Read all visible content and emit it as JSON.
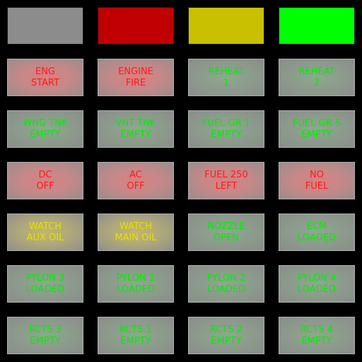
{
  "status_lights": [
    {
      "name": "status-light-gray",
      "color": "#8c8c8c"
    },
    {
      "name": "status-light-red",
      "color": "#c00000"
    },
    {
      "name": "status-light-yellow",
      "color": "#c8c000"
    },
    {
      "name": "status-light-green",
      "color": "#00ff00"
    }
  ],
  "colors": {
    "red_text": "#ff1a1a",
    "yellow_text": "#e8e000",
    "green_text": "#00ee00",
    "lamp_body": "#8c8c8c",
    "background": "#000000"
  },
  "annunciators": [
    {
      "id": "eng-start",
      "line1": "ENG",
      "line2": "START",
      "color": "red"
    },
    {
      "id": "engine-fire",
      "line1": "ENGINE",
      "line2": "FIRE",
      "color": "red"
    },
    {
      "id": "reheat-1",
      "line1": "REHEAT",
      "line2": "1",
      "color": "green"
    },
    {
      "id": "reheat-2",
      "line1": "REHEAT",
      "line2": "2",
      "color": "green"
    },
    {
      "id": "wng-tnk-empty",
      "line1": "WNG TNK",
      "line2": "EMPTY",
      "color": "green"
    },
    {
      "id": "vnt-tnk-empty",
      "line1": "VNT TNK",
      "line2": "EMPTY",
      "color": "green"
    },
    {
      "id": "fuel-gr-1-empty",
      "line1": "FUEL GR 1",
      "line2": "EMPTY",
      "color": "green"
    },
    {
      "id": "fuel-gr-5-empty",
      "line1": "FUEL GR 5",
      "line2": "EMPTY",
      "color": "green"
    },
    {
      "id": "dc-off",
      "line1": "DC",
      "line2": "OFF",
      "color": "red"
    },
    {
      "id": "ac-off",
      "line1": "AC",
      "line2": "OFF",
      "color": "red"
    },
    {
      "id": "fuel-250-left",
      "line1": "FUEL 250",
      "line2": "LEFT",
      "color": "red"
    },
    {
      "id": "no-fuel",
      "line1": "NO",
      "line2": "FUEL",
      "color": "red"
    },
    {
      "id": "watch-aux-oil",
      "line1": "WATCH",
      "line2": "AUX OIL",
      "color": "yellow"
    },
    {
      "id": "watch-main-oil",
      "line1": "WATCH",
      "line2": "MAIN OIL",
      "color": "yellow"
    },
    {
      "id": "nozzle-open",
      "line1": "NOZZLE",
      "line2": "OPEN",
      "color": "green"
    },
    {
      "id": "ecm-loaded",
      "line1": "ECM",
      "line2": "LOADED",
      "color": "green"
    },
    {
      "id": "pylon-3-loaded",
      "line1": "PYLON 3",
      "line2": "LOADED",
      "color": "green"
    },
    {
      "id": "pylon-1-loaded",
      "line1": "PYLON 1",
      "line2": "LOADED",
      "color": "green"
    },
    {
      "id": "pylon-2-loaded",
      "line1": "PYLON 2",
      "line2": "LOADED",
      "color": "green"
    },
    {
      "id": "pylon-4-loaded",
      "line1": "PYLON 4",
      "line2": "LOADED",
      "color": "green"
    },
    {
      "id": "rcts-3-empty",
      "line1": "RCTS 3",
      "line2": "EMPTY",
      "color": "green"
    },
    {
      "id": "rcts-1-empty",
      "line1": "RCTS 1",
      "line2": "EMPTY",
      "color": "green"
    },
    {
      "id": "rcts-2-empty",
      "line1": "RCTS 2",
      "line2": "EMPTY",
      "color": "green"
    },
    {
      "id": "rcts-4-empty",
      "line1": "RCTS 4",
      "line2": "EMPTY",
      "color": "green"
    }
  ]
}
